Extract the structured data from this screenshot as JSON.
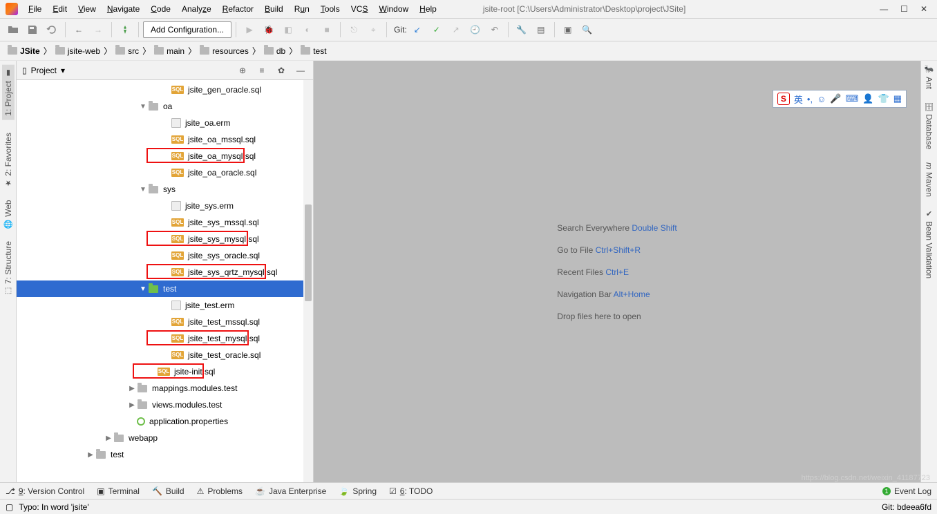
{
  "window": {
    "title": "jsite-root [C:\\Users\\Administrator\\Desktop\\project\\JSite]"
  },
  "menu": [
    "File",
    "Edit",
    "View",
    "Navigate",
    "Code",
    "Analyze",
    "Refactor",
    "Build",
    "Run",
    "Tools",
    "VCS",
    "Window",
    "Help"
  ],
  "toolbar": {
    "add_configuration": "Add Configuration...",
    "git_label": "Git:"
  },
  "breadcrumbs": [
    "JSite",
    "jsite-web",
    "src",
    "main",
    "resources",
    "db",
    "test"
  ],
  "project_panel": {
    "title": "Project"
  },
  "tree": [
    {
      "indent": 210,
      "type": "sql",
      "label": "jsite_gen_oracle.sql"
    },
    {
      "indent": 176,
      "type": "folder",
      "label": "oa",
      "arrow": "down"
    },
    {
      "indent": 210,
      "type": "erm",
      "label": "jsite_oa.erm"
    },
    {
      "indent": 210,
      "type": "sql",
      "label": "jsite_oa_mssql.sql"
    },
    {
      "indent": 210,
      "type": "sql",
      "label": "jsite_oa_mysql.sql",
      "boxed": true
    },
    {
      "indent": 210,
      "type": "sql",
      "label": "jsite_oa_oracle.sql"
    },
    {
      "indent": 176,
      "type": "folder",
      "label": "sys",
      "arrow": "down"
    },
    {
      "indent": 210,
      "type": "erm",
      "label": "jsite_sys.erm"
    },
    {
      "indent": 210,
      "type": "sql",
      "label": "jsite_sys_mssql.sql"
    },
    {
      "indent": 210,
      "type": "sql",
      "label": "jsite_sys_mysql.sql",
      "boxed": true
    },
    {
      "indent": 210,
      "type": "sql",
      "label": "jsite_sys_oracle.sql"
    },
    {
      "indent": 210,
      "type": "sql",
      "label": "jsite_sys_qrtz_mysql.sql",
      "boxed": true
    },
    {
      "indent": 176,
      "type": "folder-test",
      "label": "test",
      "arrow": "down",
      "selected": true
    },
    {
      "indent": 210,
      "type": "erm",
      "label": "jsite_test.erm"
    },
    {
      "indent": 210,
      "type": "sql",
      "label": "jsite_test_mssql.sql"
    },
    {
      "indent": 210,
      "type": "sql",
      "label": "jsite_test_mysql.sql",
      "boxed": true
    },
    {
      "indent": 210,
      "type": "sql",
      "label": "jsite_test_oracle.sql"
    },
    {
      "indent": 190,
      "type": "sql",
      "label": "jsite-init.sql",
      "boxed": true
    },
    {
      "indent": 160,
      "type": "folder",
      "label": "mappings.modules.test",
      "arrow": "right"
    },
    {
      "indent": 160,
      "type": "folder",
      "label": "views.modules.test",
      "arrow": "right"
    },
    {
      "indent": 160,
      "type": "props",
      "label": "application.properties"
    },
    {
      "indent": 126,
      "type": "folder",
      "label": "webapp",
      "arrow": "right"
    },
    {
      "indent": 100,
      "type": "folder",
      "label": "test",
      "arrow": "right"
    }
  ],
  "welcome": {
    "l1a": "Search Everywhere ",
    "l1b": "Double Shift",
    "l2a": "Go to File ",
    "l2b": "Ctrl+Shift+R",
    "l3a": "Recent Files ",
    "l3b": "Ctrl+E",
    "l4a": "Navigation Bar ",
    "l4b": "Alt+Home",
    "l5": "Drop files here to open"
  },
  "input_toolbar": {
    "ime": "英"
  },
  "left_tools": [
    "1: Project",
    "2: Favorites",
    "Web",
    "7: Structure"
  ],
  "right_tools": [
    "Ant",
    "Database",
    "Maven",
    "Bean Validation"
  ],
  "bottom_tools": [
    "9: Version Control",
    "Terminal",
    "Build",
    "Problems",
    "Java Enterprise",
    "Spring",
    "6: TODO"
  ],
  "event_log": "Event Log",
  "status": {
    "typo": "Typo: In word 'jsite'",
    "git": "Git: bdeea6fd",
    "watermark": "https://blog.csdn.net/weixin_41187723"
  }
}
